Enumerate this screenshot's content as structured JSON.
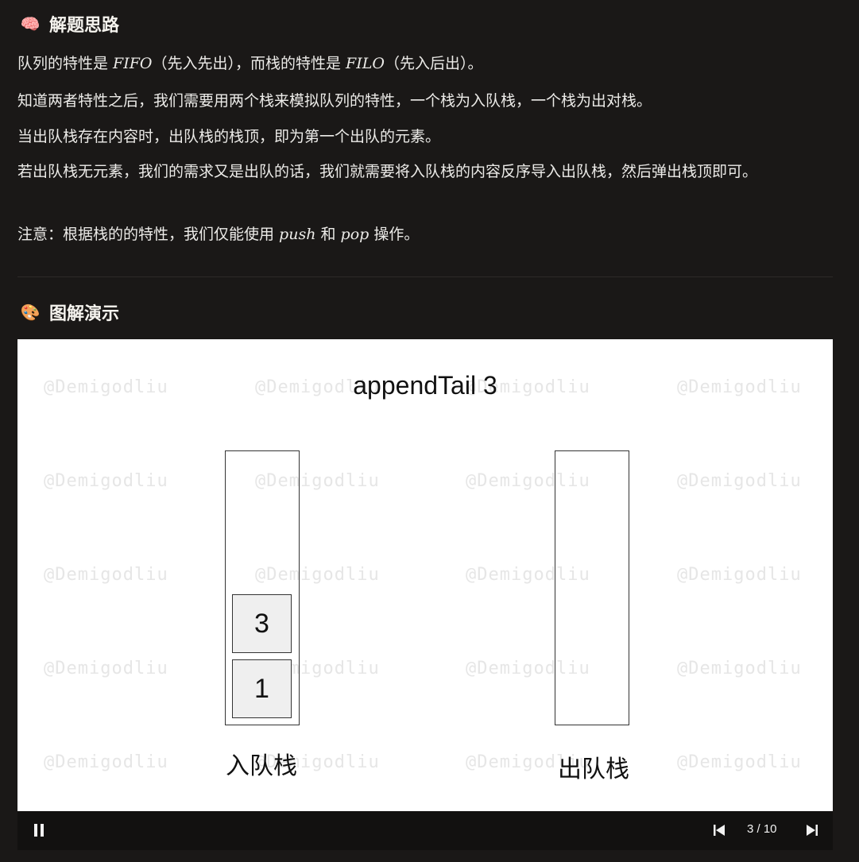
{
  "section1": {
    "emoji": "🧠",
    "title": "解题思路"
  },
  "paragraphs": {
    "p1_a": "队列的特性是 ",
    "p1_math1": "FIFO",
    "p1_b": "（先入先出），而栈的特性是 ",
    "p1_math2": "FILO",
    "p1_c": "（先入后出）。",
    "p2": "知道两者特性之后，我们需要用两个栈来模拟队列的特性，一个栈为入队栈，一个栈为出对栈。",
    "p3": "当出队栈存在内容时，出队栈的栈顶，即为第一个出队的元素。",
    "p4": "若出队栈无元素，我们的需求又是出队的话，我们就需要将入队栈的内容反序导入出队栈，然后弹出栈顶即可。",
    "p5_a": "注意：根据栈的的特性，我们仅能使用 ",
    "p5_math1": "push",
    "p5_b": " 和 ",
    "p5_math2": "pop",
    "p5_c": " 操作。"
  },
  "section2": {
    "emoji": "🎨",
    "title": "图解演示"
  },
  "animation": {
    "title": "appendTail 3",
    "watermark": "@Demigodliu",
    "in_stack_label": "入队栈",
    "out_stack_label": "出队栈",
    "in_stack_items": [
      "3",
      "1"
    ]
  },
  "player": {
    "counter": "3 / 10",
    "pause_icon": "pause-icon",
    "prev_icon": "skip-previous-icon",
    "next_icon": "skip-next-icon"
  }
}
